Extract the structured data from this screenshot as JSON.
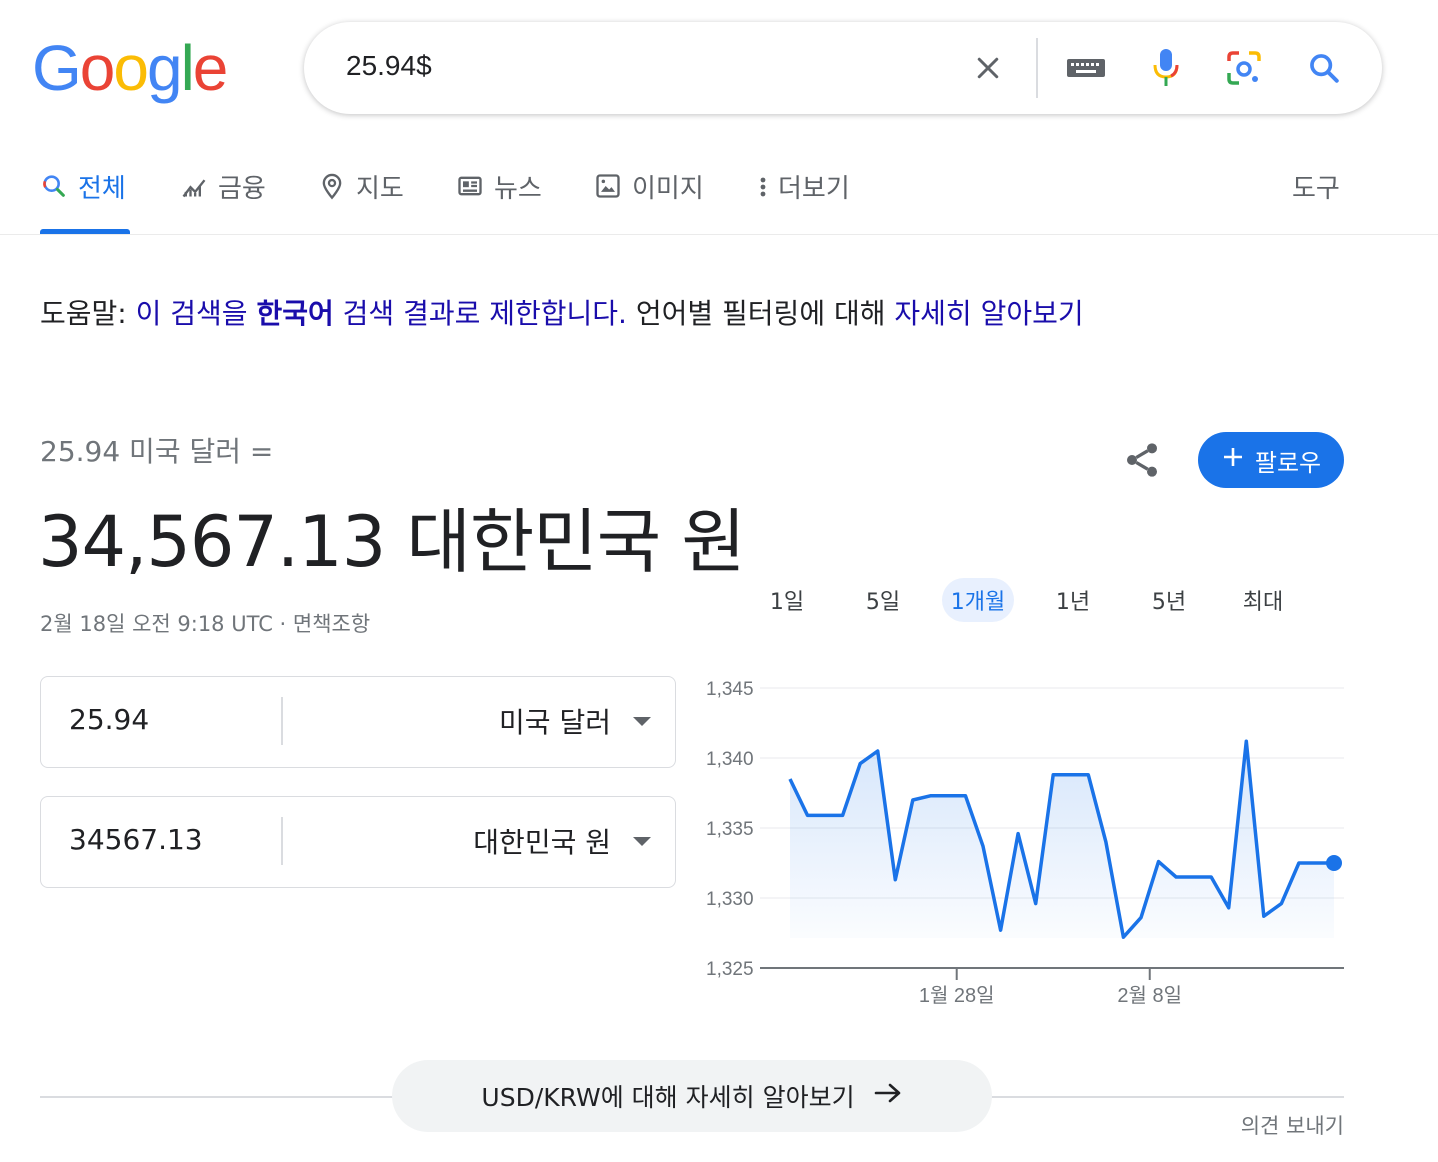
{
  "logo": {
    "letters": [
      "G",
      "o",
      "o",
      "g",
      "l",
      "e"
    ],
    "colors": [
      "#4285f4",
      "#ea4335",
      "#fbbc05",
      "#4285f4",
      "#34a853",
      "#ea4335"
    ]
  },
  "search": {
    "query": "25.94$"
  },
  "icons": {
    "clear": "close-icon",
    "keyboard": "keyboard-icon",
    "voice": "microphone-icon",
    "lens": "lens-camera-icon",
    "search": "search-icon"
  },
  "tabs": [
    {
      "label": "전체",
      "icon": "search-icon",
      "active": true
    },
    {
      "label": "금융",
      "icon": "finance-chart-icon"
    },
    {
      "label": "지도",
      "icon": "map-pin-icon"
    },
    {
      "label": "뉴스",
      "icon": "news-icon"
    },
    {
      "label": "이미지",
      "icon": "image-icon"
    },
    {
      "label": "더보기",
      "icon": "more-vert-icon"
    }
  ],
  "tools_label": "도구",
  "help": {
    "prefix": "도움말: ",
    "link1_a": "이 검색을 ",
    "link1_bold": "한국어",
    "link1_b": " 검색 결과로 제한합니다.",
    "middle": " 언어별 필터링에 대해 ",
    "link2": "자세히 알아보기"
  },
  "converter": {
    "from_line": "25.94 미국 달러 =",
    "result": "34,567.13 대한민국 원",
    "timestamp": "2월 18일 오전 9:18 UTC · 면책조항",
    "follow_label": "팔로우",
    "from": {
      "value": "25.94",
      "unit": "미국 달러"
    },
    "to": {
      "value": "34567.13",
      "unit": "대한민국 원"
    }
  },
  "ranges": [
    {
      "label": "1일"
    },
    {
      "label": "5일"
    },
    {
      "label": "1개월",
      "active": true
    },
    {
      "label": "1년"
    },
    {
      "label": "5년"
    },
    {
      "label": "최대"
    }
  ],
  "chart_data": {
    "type": "area",
    "series": [
      {
        "values": [
          1338.5,
          1335.9,
          1335.9,
          1335.9,
          1339.6,
          1340.5,
          1331.3,
          1337,
          1337.3,
          1337.3,
          1337.3,
          1333.7,
          1327.7,
          1334.6,
          1329.6,
          1338.8,
          1338.8,
          1338.8,
          1334,
          1327.2,
          1328.6,
          1332.6,
          1331.5,
          1331.5,
          1331.5,
          1329.3,
          1341.2,
          1328.7,
          1329.6,
          1332.5,
          1332.5,
          1332.5
        ]
      }
    ],
    "ylim": [
      1325,
      1345
    ],
    "y_ticks": [
      "1,345",
      "1,340",
      "1,335",
      "1,330",
      "1,325"
    ],
    "y_tick_values": [
      1345,
      1340,
      1335,
      1330,
      1325
    ],
    "x_ticks": [
      {
        "label": "1월 28일",
        "index": 9.5
      },
      {
        "label": "2월 8일",
        "index": 20.5
      }
    ],
    "line_color": "#1a73e8",
    "grid": true
  },
  "more_button": "USD/KRW에 대해 자세히 알아보기",
  "feedback": "의견 보내기"
}
